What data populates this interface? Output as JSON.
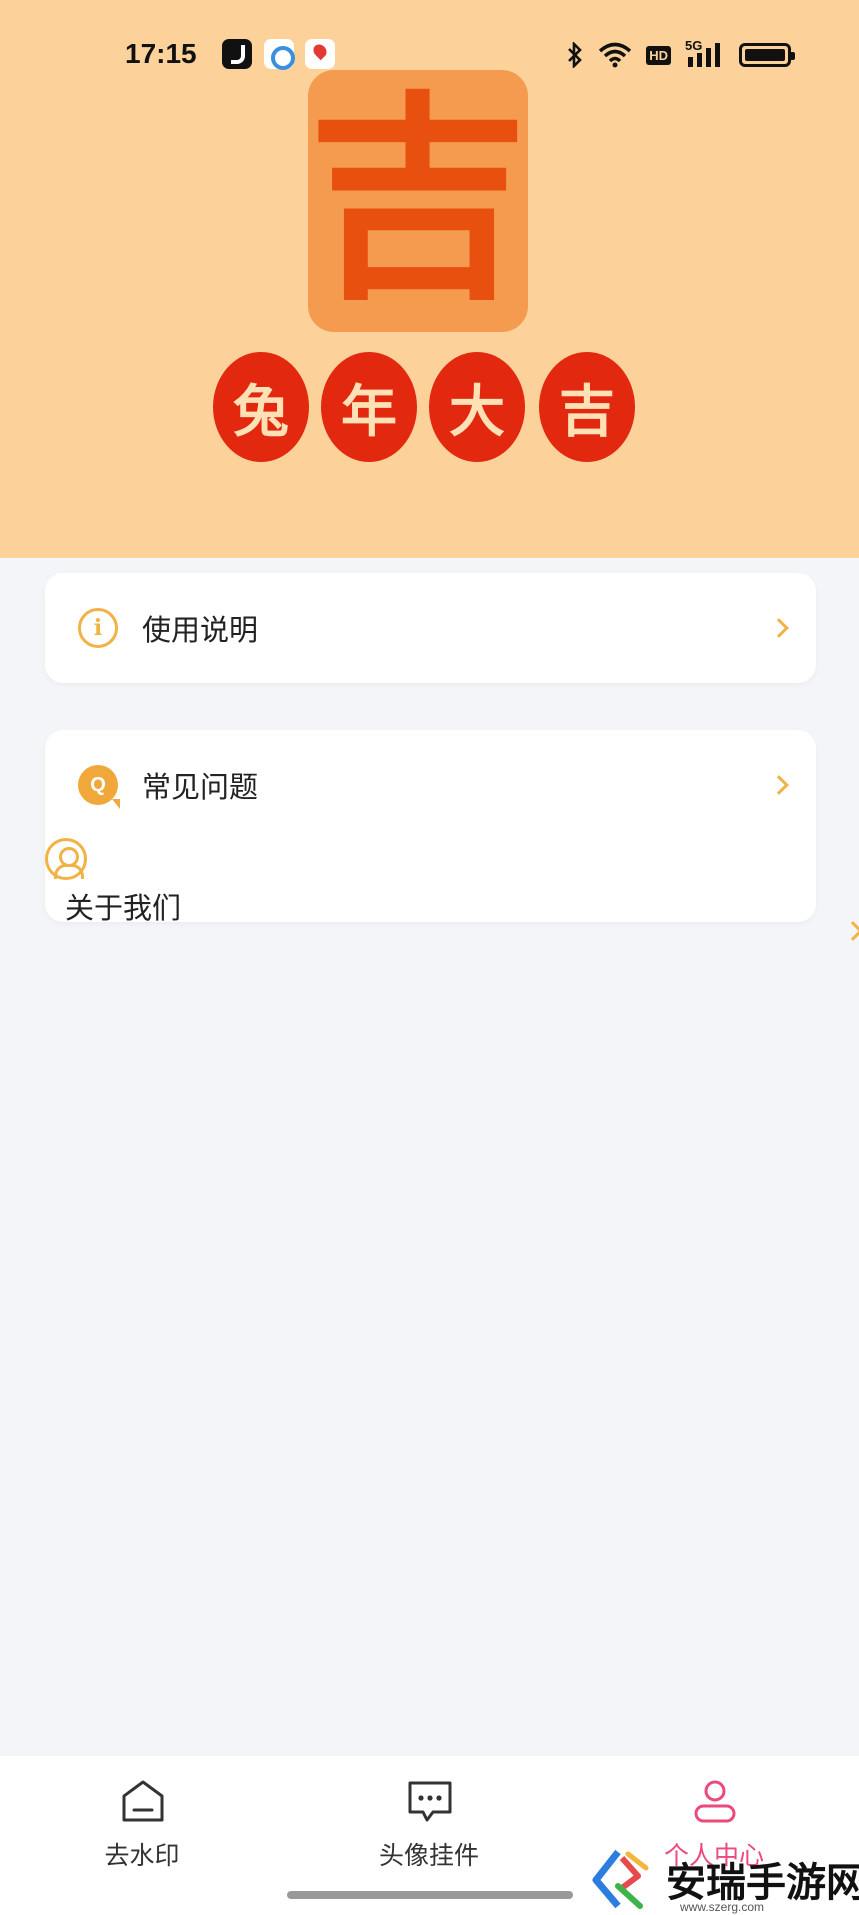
{
  "status_bar": {
    "time": "17:15",
    "apps": [
      "tiktok-icon",
      "circle-app-icon",
      "map-pin-app-icon"
    ],
    "right_icons": [
      "bluetooth-icon",
      "wifi-icon",
      "hd-icon",
      "signal-5g-icon",
      "battery-icon"
    ],
    "hd_label": "HD",
    "network_label": "5G"
  },
  "banner": {
    "big_character": "吉",
    "blessing": [
      "兔",
      "年",
      "大",
      "吉"
    ],
    "colors": {
      "background": "#fcd29a",
      "character": "#e8500f",
      "circle": "#e2280f"
    }
  },
  "menu": {
    "usage_label": "使用说明",
    "faq_label": "常见问题",
    "about_label": "关于我们"
  },
  "bottom_nav": {
    "items": [
      {
        "label": "去水印",
        "icon": "home-icon",
        "active": false
      },
      {
        "label": "头像挂件",
        "icon": "message-dots-icon",
        "active": false
      },
      {
        "label": "个人中心",
        "icon": "user-icon",
        "active": true
      }
    ],
    "active_color": "#ec4a7a"
  },
  "watermark": {
    "title": "安瑞手游网",
    "url": "www.szerg.com"
  }
}
